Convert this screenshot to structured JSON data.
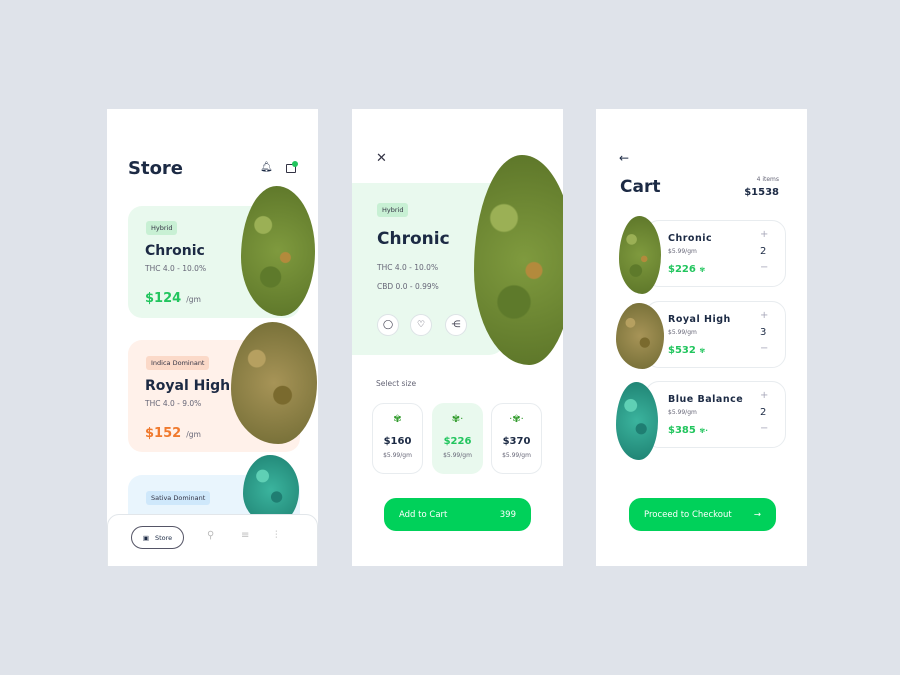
{
  "store": {
    "title": "Store",
    "cart_badge": "2",
    "products": [
      {
        "tag": "Hybrid",
        "name": "Chronic",
        "thc": "THC 4.0 - 10.0%",
        "price": "$124",
        "unit": "/gm"
      },
      {
        "tag": "Indica Dominant",
        "name": "Royal High",
        "thc": "THC 4.0 - 9.0%",
        "price": "$152",
        "unit": "/gm"
      },
      {
        "tag": "Sativa Dominant"
      }
    ],
    "nav": {
      "store_label": "Store"
    }
  },
  "detail": {
    "tag": "Hybrid",
    "name": "Chronic",
    "thc": "THC 4.0 - 10.0%",
    "cbd": "CBD 0.0 - 0.99%",
    "select_size": "Select size",
    "sizes": [
      {
        "price": "$160",
        "unit": "$5.99/gm"
      },
      {
        "price": "$226",
        "unit": "$5.99/gm"
      },
      {
        "price": "$370",
        "unit": "$5.99/gm"
      }
    ],
    "add_to_cart": "Add to Cart",
    "add_to_cart_total": "399"
  },
  "cart": {
    "title": "Cart",
    "items_count": "4 items",
    "total": "$1538",
    "checkout": "Proceed to Checkout",
    "items": [
      {
        "name": "Chronic",
        "unit": "$5.99/gm",
        "price": "$226",
        "qty": "2"
      },
      {
        "name": "Royal High",
        "unit": "$5.99/gm",
        "price": "$532",
        "qty": "3"
      },
      {
        "name": "Blue Balance",
        "unit": "$5.99/gm",
        "price": "$385",
        "qty": "2"
      }
    ]
  },
  "colors": {
    "accent": "#00d15a",
    "price_green": "#22c55e",
    "price_orange": "#f07a2e",
    "background": "#dfe3ea"
  }
}
